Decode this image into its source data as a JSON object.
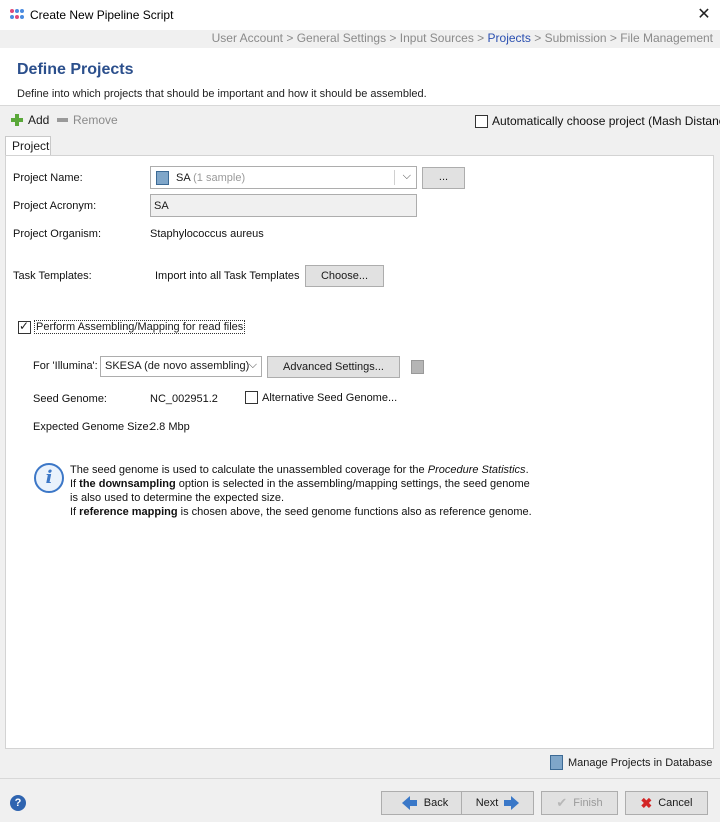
{
  "window": {
    "title": "Create New Pipeline Script",
    "close_glyph": "✕"
  },
  "breadcrumb": [
    {
      "label": "User Account",
      "active": false
    },
    {
      "label": "General Settings",
      "active": false
    },
    {
      "label": "Input Sources",
      "active": false
    },
    {
      "label": "Projects",
      "active": true
    },
    {
      "label": "Submission",
      "active": false
    },
    {
      "label": "File Management",
      "active": false
    }
  ],
  "breadcrumb_separator": " > ",
  "header": {
    "title": "Define Projects",
    "subtitle": "Define into which projects that should be important and how it should be assembled."
  },
  "toolbar": {
    "add_label": "Add",
    "remove_label": "Remove",
    "auto_choose_label": "Automatically choose project (Mash Distance)",
    "auto_choose_checked": false
  },
  "tabs": [
    {
      "label": "Project"
    }
  ],
  "form": {
    "project_name_label": "Project Name:",
    "project_name_value": "SA",
    "project_name_hint": "(1 sample)",
    "browse_label": "...",
    "acronym_label": "Project Acronym:",
    "acronym_value": "SA",
    "organism_label": "Project Organism:",
    "organism_value": "Staphylococcus aureus",
    "task_templates_label": "Task Templates:",
    "import_label": "Import into all Task Templates",
    "choose_label": "Choose...",
    "perform_label": "Perform Assembling/Mapping for read files",
    "perform_checked": true,
    "for_illumina_label": "For 'Illumina':",
    "assembler_value": "SKESA (de novo assembling)",
    "advanced_label": "Advanced Settings...",
    "seed_genome_label": "Seed Genome:",
    "seed_genome_value": "NC_002951.2",
    "alt_seed_label": "Alternative Seed Genome...",
    "alt_seed_checked": false,
    "genome_size_label": "Expected Genome Size:",
    "genome_size_value": "2.8 Mbp"
  },
  "info": {
    "line1_pre": "The seed genome is used to calculate the unassembled coverage for the ",
    "line1_em": "Procedure Statistics",
    "line1_post": ".",
    "line2_pre": "If ",
    "line2_bold": "the downsampling",
    "line2_post": " option is selected in the assembling/mapping settings, the seed genome",
    "line3": "is also used to determine the expected size.",
    "line4_pre": "If ",
    "line4_bold": "reference mapping",
    "line4_post": " is chosen above, the seed genome functions also as reference genome."
  },
  "footer": {
    "manage_label": "Manage Projects in Database",
    "back_label": "Back",
    "next_label": "Next",
    "finish_label": "Finish",
    "cancel_label": "Cancel"
  },
  "icons": {
    "add": "plus-icon",
    "remove": "minus-icon",
    "info": "info-icon",
    "help": "help-icon",
    "back": "arrow-left-icon",
    "next": "arrow-right-icon",
    "finish": "check-icon",
    "cancel": "x-icon"
  },
  "colors": {
    "title": "#2b4f8c",
    "breadcrumb_active": "#2a4fb0",
    "add_green": "#5aa83a",
    "info_blue": "#3c77c7",
    "cancel_red": "#d32525"
  }
}
